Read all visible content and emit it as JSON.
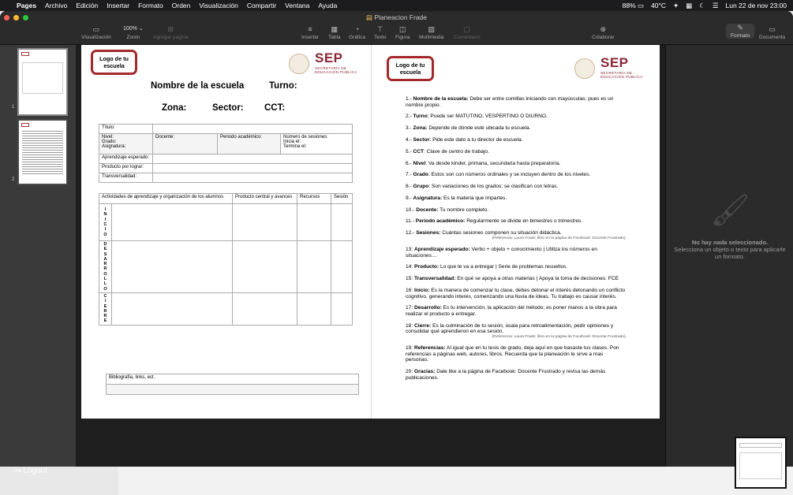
{
  "menubar": {
    "app": "Pages",
    "items": [
      "Archivo",
      "Edición",
      "Insertar",
      "Formato",
      "Orden",
      "Visualización",
      "Compartir",
      "Ventana",
      "Ayuda"
    ],
    "battery": "88%",
    "temp": "40°C",
    "datetime": "Lun 22 de nov  23:00"
  },
  "window": {
    "title": "Planeacion Frade"
  },
  "toolbar": {
    "view": "Visualización",
    "zoom_value": "100%",
    "zoom": "Zoom",
    "add_page": "Agregar página",
    "insert": "Insertar",
    "table": "Tabla",
    "chart": "Gráfica",
    "text": "Texto",
    "shape": "Figura",
    "media": "Multimedia",
    "comment": "Comentario",
    "collaborate": "Colaborar",
    "format": "Formato",
    "document": "Documento"
  },
  "sidebar": {
    "pages": [
      "1",
      "2"
    ]
  },
  "inspector": {
    "empty_title": "No hay nada seleccionado.",
    "empty_hint": "Selecciona un objeto o texto para aplicarle un formato."
  },
  "page1": {
    "logo": "Logo de tu escuela",
    "sep": "SEP",
    "sep_sub1": "SECRETARÍA DE",
    "sep_sub2": "EDUCACIÓN PÚBLICA",
    "school": "Nombre de la escuela",
    "turno": "Turno:",
    "zona": "Zona:",
    "sector": "Sector:",
    "cct": "CCT:",
    "titulo": "Título:",
    "nivel": "Nivel:",
    "grado": "Grado:",
    "asignatura": "Asignatura:",
    "docente": "Docente:",
    "periodo": "Periodo académico:",
    "sesiones": "Número de sesiones:",
    "inicia": "Inicia el:",
    "termina": "Termina el:",
    "aprendizaje": "Aprendizaje esperado:",
    "producto": "Producto por lograr:",
    "transversalidad": "Transversalidad:",
    "col_actividades": "Actividades de aprendizaje y organización de los alumnos",
    "col_producto": "Producto central y avances",
    "col_recursos": "Recursos",
    "col_sesion": "Sesión",
    "inicio": "I N I C I O",
    "desarrollo": "D E S A R R O L L O",
    "cierre": "C I E R R E",
    "biblio": "Bibliografía, links, ect."
  },
  "page2": {
    "logo": "Logo de tu escuela",
    "items": [
      {
        "n": "1.- ",
        "k": "Nombre de la escuela:",
        "t": " Debe ser entre comillas iniciando con mayúsculas; pues es un nombre propio."
      },
      {
        "n": "2.- ",
        "k": "Turno",
        "t": ": Puede ser MATUTINO, VESPERTINO O DIURNO."
      },
      {
        "n": "3.- ",
        "k": "Zona:",
        "t": " Depende de dónde esté ubicada tu escuela."
      },
      {
        "n": "4.- ",
        "k": "Sector:",
        "t": " Pide este dato a tu director de escuela."
      },
      {
        "n": "5.- ",
        "k": "CCT",
        "t": ": Clave de centro de trabajo."
      },
      {
        "n": "6.- ",
        "k": "Nivel",
        "t": ": Va desde kinder, primaria, secundaria hasta preparatoria."
      },
      {
        "n": "7.- ",
        "k": "Grado",
        "t": ": Estos son con números ordinales y se incluyen dentro de los niveles."
      },
      {
        "n": "8.- ",
        "k": "Grupo",
        "t": ": Son variaciones de los grados; se clasifican con letras."
      },
      {
        "n": "9.- ",
        "k": "Asignatura:",
        "t": " Es la materia que impartes."
      },
      {
        "n": "10.- ",
        "k": "Docente:",
        "t": " Tu nombre completo."
      },
      {
        "n": "11.- ",
        "k": "Periodo académico:",
        "t": " Regularmente se divide en bimestres o trimestres."
      },
      {
        "n": "12.- ",
        "k": "Sesiones:",
        "t": " Cuántas sesiones componen su situación didáctica.",
        "ref": "(Referencia: Laura Frade; libro en la página de Facebook: Docente Frustrado)."
      },
      {
        "n": "13: ",
        "k": "Aprendizaje esperado:",
        "t": " Verbo + objeto + conocimiento | Utiliza los números en situaciones…"
      },
      {
        "n": "14: ",
        "k": "Producto:",
        "t": " Lo que te va a entregar | Serie de problemas resueltos."
      },
      {
        "n": "15: ",
        "k": "Transversalidad:",
        "t": " En qué se apoya a otras materias | Apoya la toma de decisiones: FCE"
      },
      {
        "n": "16: ",
        "k": "Inicio:",
        "t": " Es la manera de comenzar tu clase, debes detonar el interés detonando un conflicto cognitivo, generando interés, comenzando una lluvia de ideas. Tu trabajo es causar interés."
      },
      {
        "n": "17: ",
        "k": "Desarrollo:",
        "t": " Es tu intervención, la aplicación del método; es poner manos a la obra para realizar el producto a entregar."
      },
      {
        "n": "18: ",
        "k": "Cierre:",
        "t": " Es la culminación de tu sesión, úsala para retroalimentación, pedir opiniones y consolidar qué aprendieron en esa sesión.",
        "ref": "(Referencia: Laura Frade; libro en la página de Facebook: Docente Frustrado)."
      },
      {
        "n": "19: ",
        "k": "Referencias:",
        "t": " Al igual que en tu tesis de grado, deja aquí en que basaste tus clases. Pon referencias a páginas web, autores, libros. Recuerda que la planeación le sirve a mas personas."
      },
      {
        "n": "20: ",
        "k": "Gracias:",
        "t": " Dale like a la página de Facebook: Docente Frustrado y revisa las demás publicaciones."
      }
    ]
  },
  "footer": {
    "logout": "Logout"
  }
}
